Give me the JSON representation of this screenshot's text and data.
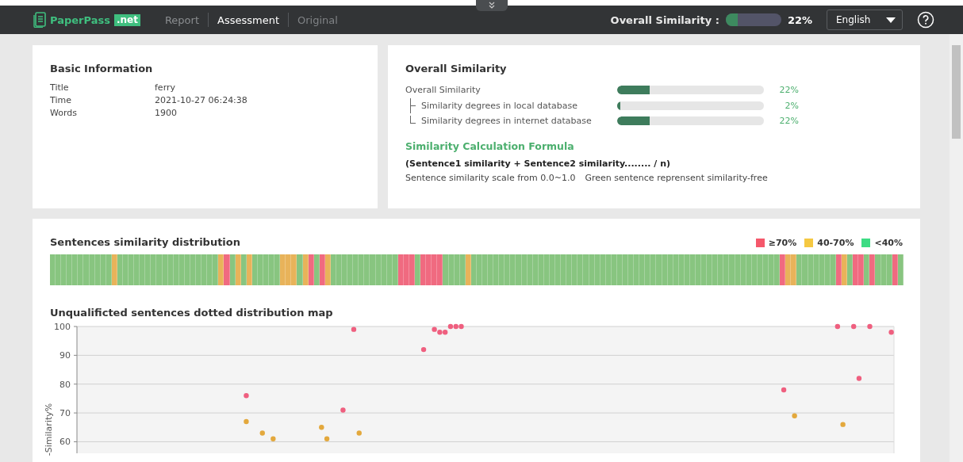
{
  "header": {
    "logo": "PaperPass",
    "logo_badge": ".net",
    "tabs": [
      {
        "label": "Report",
        "selected": false
      },
      {
        "label": "Assessment",
        "selected": true
      },
      {
        "label": "Original",
        "selected": false
      }
    ],
    "similarity": {
      "label": "Overall Similarity :",
      "level": 0.22,
      "reading": "22%"
    },
    "language": "English"
  },
  "basic_info": {
    "title": "Basic Information",
    "rows": [
      {
        "label": "Title",
        "value": "ferry"
      },
      {
        "label": "Time",
        "value": "2021-10-27 06:24:38"
      },
      {
        "label": "Words",
        "value": "1900"
      }
    ]
  },
  "overall": {
    "title": "Overall Similarity",
    "rows": [
      {
        "kind": "total",
        "label": "Overall Similarity",
        "level": 0.22,
        "reading": "22%"
      },
      {
        "kind": "branch",
        "label": "Similarity degrees in local database",
        "level": 0.02,
        "reading": "2%"
      },
      {
        "kind": "last-branch",
        "label": "Similarity degrees in internet database",
        "level": 0.22,
        "reading": "22%"
      }
    ],
    "formula_title": "Similarity Calculation Formula",
    "formula": "(Sentence1 similarity + Sentence2 similarity........ / n)",
    "notes": [
      "Sentence similarity scale from 0.0~1.0",
      "Green sentence reprensent similarity-free"
    ]
  },
  "distribution": {
    "title": "Sentences similarity distribution",
    "legend": [
      {
        "label": "≥70%",
        "color": "#f5586b"
      },
      {
        "label": "40-70%",
        "color": "#f5c842"
      },
      {
        "label": "<40%",
        "color": "#3ddc84"
      }
    ],
    "segments": [
      {
        "kind": "low"
      },
      {
        "kind": "low"
      },
      {
        "kind": "low"
      },
      {
        "kind": "low"
      },
      {
        "kind": "low"
      },
      {
        "kind": "low"
      },
      {
        "kind": "low"
      },
      {
        "kind": "low"
      },
      {
        "kind": "low"
      },
      {
        "kind": "low"
      },
      {
        "kind": "low"
      },
      {
        "kind": "mid"
      },
      {
        "kind": "low"
      },
      {
        "kind": "low"
      },
      {
        "kind": "low"
      },
      {
        "kind": "low"
      },
      {
        "kind": "low"
      },
      {
        "kind": "low"
      },
      {
        "kind": "low"
      },
      {
        "kind": "low"
      },
      {
        "kind": "low"
      },
      {
        "kind": "low"
      },
      {
        "kind": "low"
      },
      {
        "kind": "low"
      },
      {
        "kind": "low"
      },
      {
        "kind": "low"
      },
      {
        "kind": "low"
      },
      {
        "kind": "low"
      },
      {
        "kind": "low"
      },
      {
        "kind": "low"
      },
      {
        "kind": "mid"
      },
      {
        "kind": "high"
      },
      {
        "kind": "low"
      },
      {
        "kind": "mid"
      },
      {
        "kind": "low"
      },
      {
        "kind": "mid"
      },
      {
        "kind": "low"
      },
      {
        "kind": "low"
      },
      {
        "kind": "low"
      },
      {
        "kind": "low"
      },
      {
        "kind": "low"
      },
      {
        "kind": "mid"
      },
      {
        "kind": "mid"
      },
      {
        "kind": "mid"
      },
      {
        "kind": "low"
      },
      {
        "kind": "mid"
      },
      {
        "kind": "high"
      },
      {
        "kind": "low"
      },
      {
        "kind": "high"
      },
      {
        "kind": "mid"
      },
      {
        "kind": "low"
      },
      {
        "kind": "low"
      },
      {
        "kind": "low"
      },
      {
        "kind": "low"
      },
      {
        "kind": "low"
      },
      {
        "kind": "low"
      },
      {
        "kind": "low"
      },
      {
        "kind": "low"
      },
      {
        "kind": "low"
      },
      {
        "kind": "low"
      },
      {
        "kind": "low"
      },
      {
        "kind": "low"
      },
      {
        "kind": "high"
      },
      {
        "kind": "high"
      },
      {
        "kind": "high"
      },
      {
        "kind": "low"
      },
      {
        "kind": "high"
      },
      {
        "kind": "high"
      },
      {
        "kind": "high"
      },
      {
        "kind": "high"
      },
      {
        "kind": "low"
      },
      {
        "kind": "low"
      },
      {
        "kind": "low"
      },
      {
        "kind": "low"
      },
      {
        "kind": "mid"
      },
      {
        "kind": "low"
      },
      {
        "kind": "low"
      },
      {
        "kind": "low"
      },
      {
        "kind": "low"
      },
      {
        "kind": "low"
      },
      {
        "kind": "low"
      },
      {
        "kind": "low"
      },
      {
        "kind": "low"
      },
      {
        "kind": "low"
      },
      {
        "kind": "low"
      },
      {
        "kind": "low"
      },
      {
        "kind": "low"
      },
      {
        "kind": "low"
      },
      {
        "kind": "low"
      },
      {
        "kind": "low"
      },
      {
        "kind": "low"
      },
      {
        "kind": "low"
      },
      {
        "kind": "low"
      },
      {
        "kind": "low"
      },
      {
        "kind": "low"
      },
      {
        "kind": "low"
      },
      {
        "kind": "low"
      },
      {
        "kind": "low"
      },
      {
        "kind": "low"
      },
      {
        "kind": "low"
      },
      {
        "kind": "low"
      },
      {
        "kind": "low"
      },
      {
        "kind": "low"
      },
      {
        "kind": "low"
      },
      {
        "kind": "low"
      },
      {
        "kind": "low"
      },
      {
        "kind": "low"
      },
      {
        "kind": "low"
      },
      {
        "kind": "low"
      },
      {
        "kind": "low"
      },
      {
        "kind": "low"
      },
      {
        "kind": "low"
      },
      {
        "kind": "low"
      },
      {
        "kind": "low"
      },
      {
        "kind": "low"
      },
      {
        "kind": "low"
      },
      {
        "kind": "low"
      },
      {
        "kind": "low"
      },
      {
        "kind": "low"
      },
      {
        "kind": "low"
      },
      {
        "kind": "low"
      },
      {
        "kind": "low"
      },
      {
        "kind": "low"
      },
      {
        "kind": "low"
      },
      {
        "kind": "low"
      },
      {
        "kind": "low"
      },
      {
        "kind": "low"
      },
      {
        "kind": "low"
      },
      {
        "kind": "low"
      },
      {
        "kind": "low"
      },
      {
        "kind": "high"
      },
      {
        "kind": "mid"
      },
      {
        "kind": "mid"
      },
      {
        "kind": "low"
      },
      {
        "kind": "low"
      },
      {
        "kind": "low"
      },
      {
        "kind": "low"
      },
      {
        "kind": "low"
      },
      {
        "kind": "low"
      },
      {
        "kind": "low"
      },
      {
        "kind": "high"
      },
      {
        "kind": "mid"
      },
      {
        "kind": "low"
      },
      {
        "kind": "high"
      },
      {
        "kind": "high"
      },
      {
        "kind": "low"
      },
      {
        "kind": "high"
      },
      {
        "kind": "low"
      },
      {
        "kind": "low"
      },
      {
        "kind": "low"
      },
      {
        "kind": "high"
      },
      {
        "kind": "low"
      }
    ]
  },
  "scatter": {
    "title": "Unqualificted sentences dotted distribution map",
    "chart_data": {
      "type": "scatter",
      "grid": true,
      "ylabel": "-Similarity%",
      "ylim": [
        56,
        100
      ],
      "yticks": [
        60,
        70,
        80,
        90,
        100
      ],
      "categories": [
        null,
        null,
        null,
        null,
        null,
        null,
        null,
        null,
        null,
        null,
        null,
        null,
        null,
        null,
        null,
        null,
        null,
        null,
        null,
        null,
        null,
        null,
        null,
        null,
        null,
        null,
        null,
        null,
        null,
        null,
        null,
        null,
        null,
        null,
        null,
        null,
        null,
        null,
        null,
        null,
        null,
        null,
        null,
        null,
        null,
        null,
        null,
        null,
        null,
        null,
        null,
        null,
        null,
        null,
        null,
        null,
        null,
        null,
        null,
        null,
        null,
        null,
        null,
        null,
        null,
        null,
        null,
        null,
        null,
        null,
        null,
        null,
        null,
        null,
        null,
        null,
        null,
        null,
        null,
        null,
        null,
        null,
        null,
        null,
        null,
        null,
        null,
        null,
        null,
        null,
        null,
        null,
        null,
        null,
        null,
        null,
        null,
        null,
        null,
        null,
        null,
        null,
        null,
        null,
        null,
        null,
        null,
        null,
        null,
        null,
        null,
        null,
        null,
        null,
        null,
        null,
        null,
        null,
        null,
        null,
        null,
        null,
        null,
        null,
        null,
        null,
        null,
        null,
        null,
        null,
        null,
        null,
        null,
        null,
        null,
        null,
        null,
        null,
        null,
        null,
        null,
        null,
        null,
        null,
        null,
        null,
        null,
        null,
        null,
        null,
        null,
        null
      ],
      "series": [
        {
          "color": "#ef5f7f",
          "values": [
            null,
            null,
            null,
            null,
            null,
            null,
            null,
            null,
            null,
            null,
            null,
            null,
            null,
            null,
            null,
            null,
            null,
            null,
            null,
            null,
            null,
            null,
            null,
            null,
            null,
            null,
            null,
            null,
            null,
            null,
            null,
            76,
            null,
            null,
            null,
            null,
            null,
            null,
            null,
            null,
            null,
            null,
            null,
            null,
            null,
            null,
            null,
            null,
            null,
            71,
            null,
            99,
            null,
            null,
            null,
            null,
            null,
            null,
            null,
            null,
            null,
            null,
            null,
            null,
            92,
            null,
            99,
            98,
            98,
            100,
            100,
            100,
            null,
            null,
            null,
            null,
            null,
            null,
            null,
            null,
            null,
            null,
            null,
            null,
            null,
            null,
            null,
            null,
            null,
            null,
            null,
            null,
            null,
            null,
            null,
            null,
            null,
            null,
            null,
            null,
            null,
            null,
            null,
            null,
            null,
            null,
            null,
            null,
            null,
            null,
            null,
            null,
            null,
            null,
            null,
            null,
            null,
            null,
            null,
            null,
            null,
            null,
            null,
            null,
            null,
            null,
            null,
            null,
            null,
            null,
            null,
            78,
            null,
            null,
            null,
            null,
            null,
            null,
            null,
            null,
            null,
            100,
            null,
            null,
            100,
            82,
            null,
            100,
            null,
            null,
            null,
            98
          ]
        },
        {
          "color": "#e3a83c",
          "values": [
            null,
            null,
            null,
            null,
            null,
            null,
            null,
            null,
            null,
            null,
            null,
            null,
            null,
            null,
            null,
            null,
            null,
            null,
            null,
            null,
            null,
            null,
            null,
            null,
            null,
            null,
            null,
            null,
            null,
            null,
            null,
            67,
            null,
            null,
            63,
            null,
            61,
            null,
            null,
            null,
            null,
            null,
            null,
            null,
            null,
            65,
            61,
            null,
            null,
            null,
            null,
            null,
            63,
            null,
            null,
            null,
            null,
            null,
            null,
            null,
            null,
            null,
            null,
            null,
            null,
            null,
            null,
            null,
            null,
            null,
            null,
            null,
            null,
            null,
            null,
            null,
            null,
            null,
            null,
            null,
            null,
            null,
            null,
            null,
            null,
            null,
            null,
            null,
            null,
            null,
            null,
            null,
            null,
            null,
            null,
            null,
            null,
            null,
            null,
            null,
            null,
            null,
            null,
            null,
            null,
            null,
            null,
            null,
            null,
            null,
            null,
            null,
            null,
            null,
            null,
            null,
            null,
            null,
            null,
            null,
            null,
            null,
            null,
            null,
            null,
            null,
            null,
            null,
            null,
            null,
            null,
            null,
            null,
            69,
            null,
            null,
            null,
            null,
            null,
            null,
            null,
            null,
            66,
            null,
            null,
            null,
            null,
            null,
            null,
            null,
            null,
            null
          ]
        }
      ]
    }
  }
}
